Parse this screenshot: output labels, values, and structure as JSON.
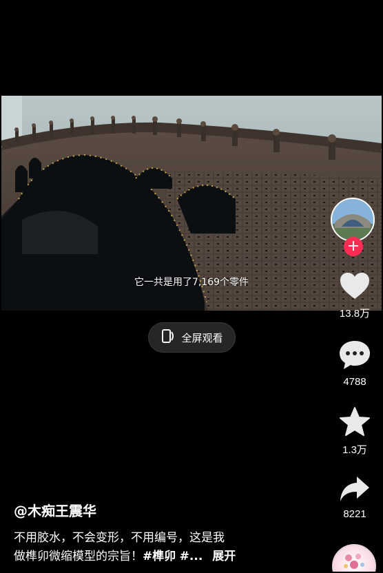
{
  "video": {
    "subtitle": "它一共是用了7,169个零件"
  },
  "fullscreen": {
    "label": "全屏观看",
    "icon": "fullscreen-phone-icon"
  },
  "rail": {
    "avatar_icon": "bridge-thumbnail",
    "follow_symbol": "+",
    "like_count": "13.8万",
    "comment_count": "4788",
    "favorite_count": "1.3万",
    "share_count": "8221"
  },
  "caption": {
    "author": "@木痴王震华",
    "line1": "不用胶水，不会变形，不用编号，这是我",
    "line2_text": "做榫卯微缩模型的宗旨！",
    "hashtag1": "#榫卯",
    "hashtag2": "#...",
    "expand_label": "展开"
  },
  "colors": {
    "background": "#000000",
    "follow_accent": "#fe2c55",
    "text": "#ffffff"
  }
}
